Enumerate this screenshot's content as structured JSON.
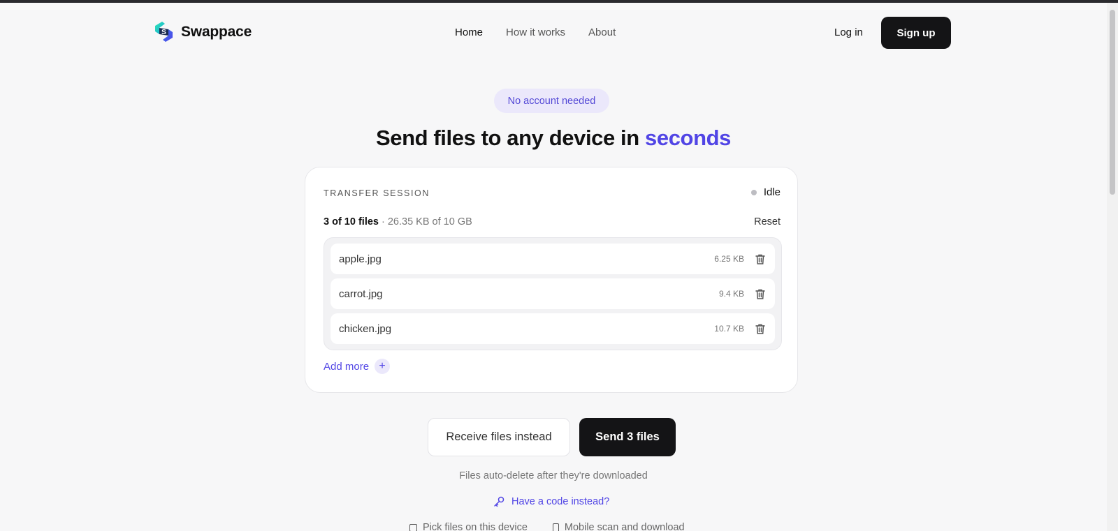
{
  "header": {
    "logo_text": "Swappace",
    "nav": [
      "Home",
      "How it works",
      "About"
    ],
    "login_label": "Log in",
    "signup_label": "Sign up"
  },
  "hero": {
    "badge": "No account needed",
    "headline_main": "Send files to any device in",
    "headline_accent": "seconds"
  },
  "session": {
    "label": "TRANSFER SESSION",
    "status": "Idle",
    "count_text": "3 of 10 files",
    "size_text": " · 26.35 KB of 10 GB",
    "reset_label": "Reset",
    "files": [
      {
        "name": "apple.jpg",
        "size": "6.25 KB"
      },
      {
        "name": "carrot.jpg",
        "size": "9.4 KB"
      },
      {
        "name": "chicken.jpg",
        "size": "10.7 KB"
      }
    ],
    "add_more_label": "Add more"
  },
  "actions": {
    "receive_label": "Receive files instead",
    "send_label": "Send 3 files",
    "note": "Files auto-delete after they're downloaded",
    "code_link": "Have a code instead?",
    "modes": [
      "Pick files on this device",
      "Mobile scan and download"
    ]
  },
  "colors": {
    "accent": "#5145e5",
    "badge_bg": "#ebe8fb",
    "primary_button": "#141416",
    "status_idle": "#bdbdc2"
  }
}
